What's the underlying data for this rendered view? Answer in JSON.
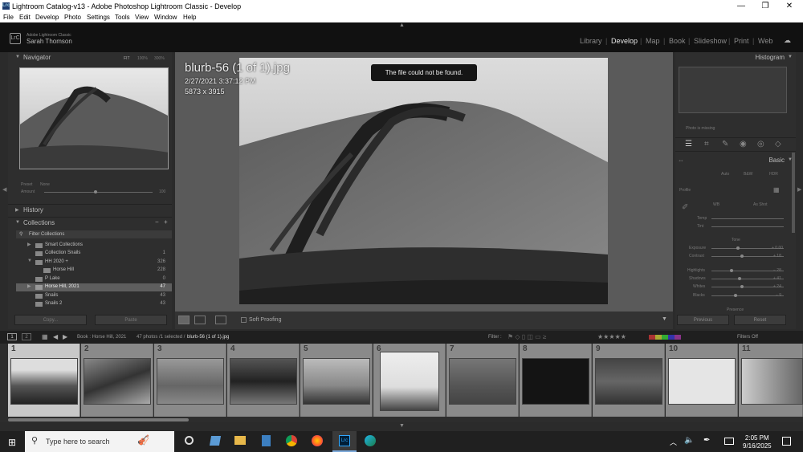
{
  "window": {
    "title": "Lightroom Catalog-v13 - Adobe Photoshop Lightroom Classic - Develop",
    "app_icon": "Lrc",
    "controls": [
      "—",
      "❐",
      "✕"
    ]
  },
  "menu": [
    "File",
    "Edit",
    "Develop",
    "Photo",
    "Settings",
    "Tools",
    "View",
    "Window",
    "Help"
  ],
  "identity": {
    "badge": "LrC",
    "product": "Adobe Lightroom Classic",
    "user": "Sarah Thomson"
  },
  "modules": [
    "Library",
    "Develop",
    "Map",
    "Book",
    "Slideshow",
    "Print",
    "Web"
  ],
  "active_module": "Develop",
  "left_panel": {
    "navigator": {
      "title": "Navigator",
      "zoom": [
        "FIT",
        "100%",
        "300%"
      ]
    },
    "preset_label": "Preset",
    "preset_value": "None",
    "amount_label": "Amount",
    "amount_value": "100",
    "history_title": "History",
    "collections_title": "Collections",
    "collections_controls": [
      "−",
      "+"
    ],
    "filter_label": "Filter Collections",
    "collections": [
      {
        "label": "Smart Collections",
        "count": ""
      },
      {
        "label": "Collection Snails",
        "count": "1"
      },
      {
        "label": "HH 2020 +",
        "count": "326"
      },
      {
        "label": "Horse Hill",
        "count": "228"
      },
      {
        "label": "P Lake",
        "count": "0"
      },
      {
        "label": "Horse Hill, 2021",
        "count": "47"
      },
      {
        "label": "Snails",
        "count": "43"
      },
      {
        "label": "Snails 2",
        "count": "43"
      }
    ],
    "copy_label": "Copy...",
    "paste_label": "Paste"
  },
  "center": {
    "filename": "blurb-56 (1 of 1).jpg",
    "datetime": "2/27/2021 3:37:12 PM",
    "dimensions": "5873 x 3915",
    "toast": "The file could not be found.",
    "soft_proofing": "Soft Proofing"
  },
  "right_panel": {
    "histogram_title": "Histogram",
    "photo_missing": "Photo is missing",
    "basic_title": "Basic",
    "auto_buttons": [
      "Auto",
      "B&W",
      "HDR"
    ],
    "profile_label": "Profile",
    "wb_label": "WB",
    "wb_value": "As Shot",
    "sliders_top": [
      "Temp",
      "Tint"
    ],
    "tone_label": "Tone",
    "tone_sliders": [
      {
        "label": "Exposure",
        "value": "+ 0.00"
      },
      {
        "label": "Contrast",
        "value": "+ 18"
      },
      {
        "label": "Highlights",
        "value": "− 28"
      },
      {
        "label": "Shadows",
        "value": "+ 41"
      },
      {
        "label": "Whites",
        "value": "+ 24"
      },
      {
        "label": "Blacks",
        "value": "− 9"
      }
    ],
    "presence_label": "Presence",
    "previous_label": "Previous",
    "reset_label": "Reset"
  },
  "filmstrip": {
    "views": [
      "1",
      "2"
    ],
    "path": "Book : Horse Hill, 2021",
    "selection": "47 photos /1 selected /",
    "current": "blurb-56 (1 of 1).jpg",
    "filter_label": "Filter :",
    "filters_off": "Filters Off",
    "cells": [
      "1",
      "2",
      "3",
      "4",
      "5",
      "6",
      "7",
      "8",
      "9",
      "10",
      "11"
    ]
  },
  "taskbar": {
    "search_placeholder": "Type here to search",
    "time": "2:05 PM",
    "date": "9/16/2025"
  },
  "colors": {
    "title_bg": "#ffffff",
    "panel_bg": "#2e2e2e",
    "center_bg": "#5a5a5a",
    "taskbar_bg": "#202020",
    "active_text": "#e4e4e4"
  }
}
